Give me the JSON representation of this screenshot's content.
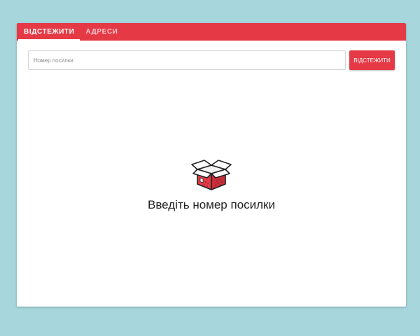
{
  "colors": {
    "accent": "#e63946",
    "background": "#a7d7dc",
    "card": "#ffffff"
  },
  "tabs": [
    {
      "label": "ВІДСТЕЖИТИ",
      "active": true
    },
    {
      "label": "АДРЕСИ",
      "active": false
    }
  ],
  "search": {
    "placeholder": "Номер посилки",
    "value": "",
    "button_label": "ВІДСТЕЖИТИ"
  },
  "empty_state": {
    "icon": "open-box-icon",
    "message": "Введіть номер посилки"
  }
}
